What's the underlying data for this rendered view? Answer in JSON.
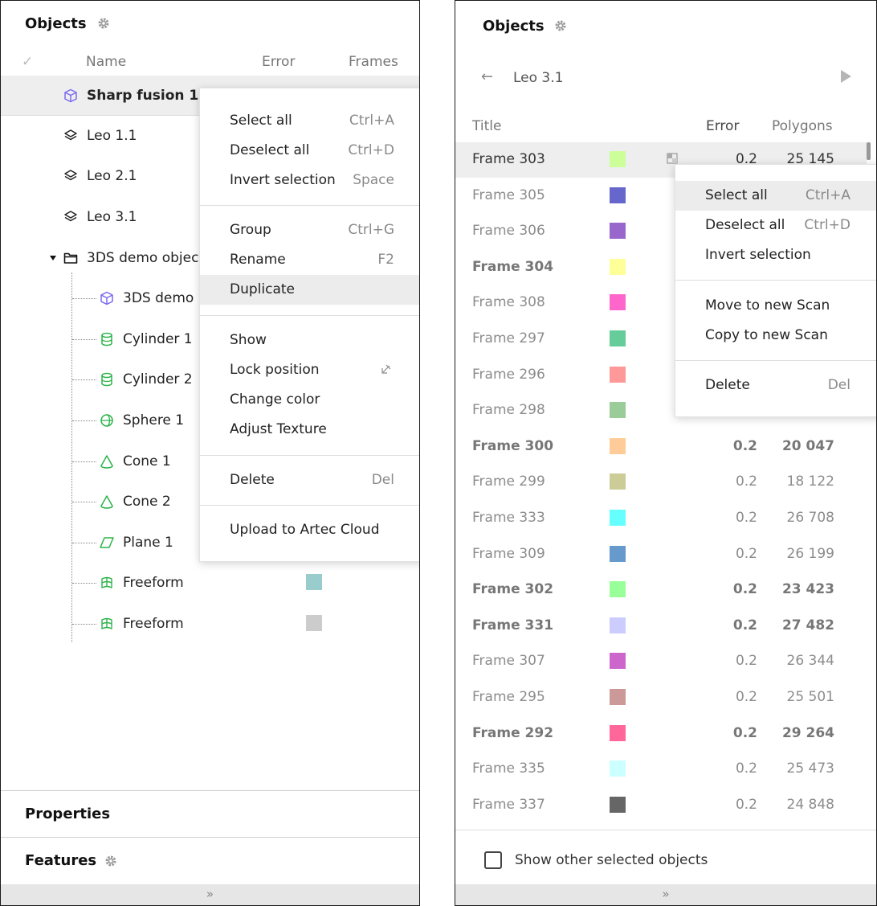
{
  "left": {
    "title": "Objects",
    "columns": {
      "check": "✓",
      "name": "Name",
      "error": "Error",
      "frames": "Frames"
    },
    "tree": [
      {
        "label": "Sharp fusion 1",
        "icon": "cube-icon",
        "selected": true
      },
      {
        "label": "Leo 1.1",
        "icon": "layers-icon"
      },
      {
        "label": "Leo 2.1",
        "icon": "layers-icon"
      },
      {
        "label": "Leo 3.1",
        "icon": "layers-icon"
      },
      {
        "label": "3DS demo objec",
        "icon": "folder-icon",
        "expanded": true
      },
      {
        "label": "3DS demo",
        "icon": "cube-icon"
      },
      {
        "label": "Cylinder 1",
        "icon": "cylinder-icon"
      },
      {
        "label": "Cylinder 2",
        "icon": "cylinder-icon"
      },
      {
        "label": "Sphere 1",
        "icon": "sphere-icon"
      },
      {
        "label": "Cone 1",
        "icon": "cone-icon"
      },
      {
        "label": "Cone 2",
        "icon": "cone-icon"
      },
      {
        "label": "Plane 1",
        "icon": "plane-icon"
      },
      {
        "label": "Freeform",
        "icon": "freeform-icon",
        "color": "#99cccc"
      },
      {
        "label": "Freeform",
        "icon": "freeform-icon",
        "color": "#cccccc"
      }
    ],
    "context_menu": [
      {
        "label": "Select all",
        "shortcut": "Ctrl+A"
      },
      {
        "label": "Deselect all",
        "shortcut": "Ctrl+D"
      },
      {
        "label": "Invert selection",
        "shortcut": "Space"
      },
      {
        "label": "Group",
        "shortcut": "Ctrl+G"
      },
      {
        "label": "Rename",
        "shortcut": "F2"
      },
      {
        "label": "Duplicate",
        "shortcut": "",
        "highlighted": true
      },
      {
        "label": "Show",
        "shortcut": ""
      },
      {
        "label": "Lock position",
        "shortcut": "",
        "icon": "lock-position-icon"
      },
      {
        "label": "Change color",
        "shortcut": ""
      },
      {
        "label": "Adjust Texture",
        "shortcut": ""
      },
      {
        "label": "Delete",
        "shortcut": "Del"
      },
      {
        "label": "Upload to Artec Cloud",
        "shortcut": ""
      }
    ],
    "properties_title": "Properties",
    "features_title": "Features",
    "expand_glyph": "»"
  },
  "right": {
    "title": "Objects",
    "back_glyph": "←",
    "nav_title": "Leo 3.1",
    "columns": {
      "title": "Title",
      "error": "Error",
      "polygons": "Polygons"
    },
    "frames": [
      {
        "title": "Frame 303",
        "color": "#ccff99",
        "error": "0.2",
        "polygons": "25 145",
        "selected": true,
        "bold": false
      },
      {
        "title": "Frame 305",
        "color": "#6666cc",
        "error": "",
        "polygons": "",
        "bold": false
      },
      {
        "title": "Frame 306",
        "color": "#9966cc",
        "error": "",
        "polygons": "",
        "bold": false
      },
      {
        "title": "Frame 304",
        "color": "#ffff99",
        "error": "",
        "polygons": "",
        "bold": true
      },
      {
        "title": "Frame 308",
        "color": "#ff66cc",
        "error": "",
        "polygons": "",
        "bold": false
      },
      {
        "title": "Frame 297",
        "color": "#66cc99",
        "error": "",
        "polygons": "",
        "bold": false
      },
      {
        "title": "Frame 296",
        "color": "#ff9999",
        "error": "",
        "polygons": "",
        "bold": false
      },
      {
        "title": "Frame 298",
        "color": "#99cc99",
        "error": "",
        "polygons": "",
        "bold": false
      },
      {
        "title": "Frame 300",
        "color": "#ffcc99",
        "error": "0.2",
        "polygons": "20 047",
        "bold": true
      },
      {
        "title": "Frame 299",
        "color": "#cccc99",
        "error": "0.2",
        "polygons": "18 122",
        "bold": false
      },
      {
        "title": "Frame 333",
        "color": "#66ffff",
        "error": "0.2",
        "polygons": "26 708",
        "bold": false
      },
      {
        "title": "Frame 309",
        "color": "#6699cc",
        "error": "0.2",
        "polygons": "26 199",
        "bold": false
      },
      {
        "title": "Frame 302",
        "color": "#99ff99",
        "error": "0.2",
        "polygons": "23 423",
        "bold": true
      },
      {
        "title": "Frame 331",
        "color": "#ccccff",
        "error": "0.2",
        "polygons": "27 482",
        "bold": true
      },
      {
        "title": "Frame 307",
        "color": "#cc66cc",
        "error": "0.2",
        "polygons": "26 344",
        "bold": false
      },
      {
        "title": "Frame 295",
        "color": "#cc9999",
        "error": "0.2",
        "polygons": "25 501",
        "bold": false
      },
      {
        "title": "Frame 292",
        "color": "#ff6699",
        "error": "0.2",
        "polygons": "29 264",
        "bold": true
      },
      {
        "title": "Frame 335",
        "color": "#ccffff",
        "error": "0.2",
        "polygons": "25 473",
        "bold": false
      },
      {
        "title": "Frame 337",
        "color": "#666666",
        "error": "0.2",
        "polygons": "24 848",
        "bold": false
      }
    ],
    "context_menu": [
      {
        "label": "Select all",
        "shortcut": "Ctrl+A",
        "highlighted": true
      },
      {
        "label": "Deselect all",
        "shortcut": "Ctrl+D"
      },
      {
        "label": "Invert selection",
        "shortcut": ""
      },
      {
        "label": "Move to new Scan",
        "shortcut": ""
      },
      {
        "label": "Copy to new Scan",
        "shortcut": ""
      },
      {
        "label": "Delete",
        "shortcut": "Del"
      }
    ],
    "show_other_label": "Show other selected objects",
    "show_other_checked": false,
    "expand_glyph": "»"
  }
}
